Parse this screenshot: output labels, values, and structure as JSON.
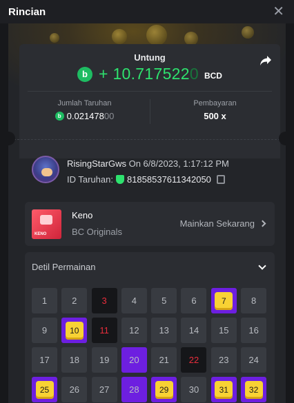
{
  "header": {
    "title": "Rincian",
    "close_symbol": "✕"
  },
  "summary": {
    "profit_label": "Untung",
    "profit_prefix": "+ ",
    "profit_main": "10.717522",
    "profit_trailing": "0",
    "currency": "BCD",
    "currency_icon": "bc-coin-icon",
    "bet_label": "Jumlah Taruhan",
    "bet_main": "0.021478",
    "bet_trailing": "00",
    "payout_label": "Pembayaran",
    "payout_value": "500 x",
    "accent_color": "#2ee26e"
  },
  "player": {
    "name": "RisingStarGws",
    "on_text": "On 6/8/2023, 1:17:12 PM",
    "bet_id_label": "ID Taruhan:",
    "bet_id": "81858537611342050"
  },
  "game": {
    "name": "Keno",
    "provider": "BC Originals",
    "play_label": "Mainkan Sekarang",
    "thumb_tag": "KENO"
  },
  "details": {
    "title": "Detil Permainan",
    "tiles": [
      {
        "n": "1",
        "s": "normal"
      },
      {
        "n": "2",
        "s": "normal"
      },
      {
        "n": "3",
        "s": "drawn"
      },
      {
        "n": "4",
        "s": "normal"
      },
      {
        "n": "5",
        "s": "normal"
      },
      {
        "n": "6",
        "s": "normal"
      },
      {
        "n": "7",
        "s": "hit"
      },
      {
        "n": "8",
        "s": "normal"
      },
      {
        "n": "9",
        "s": "normal"
      },
      {
        "n": "10",
        "s": "hit"
      },
      {
        "n": "11",
        "s": "drawn"
      },
      {
        "n": "12",
        "s": "normal"
      },
      {
        "n": "13",
        "s": "normal"
      },
      {
        "n": "14",
        "s": "normal"
      },
      {
        "n": "15",
        "s": "normal"
      },
      {
        "n": "16",
        "s": "normal"
      },
      {
        "n": "17",
        "s": "normal"
      },
      {
        "n": "18",
        "s": "normal"
      },
      {
        "n": "19",
        "s": "normal"
      },
      {
        "n": "20",
        "s": "picked"
      },
      {
        "n": "21",
        "s": "normal"
      },
      {
        "n": "22",
        "s": "drawn"
      },
      {
        "n": "23",
        "s": "normal"
      },
      {
        "n": "24",
        "s": "normal"
      },
      {
        "n": "25",
        "s": "hit"
      },
      {
        "n": "26",
        "s": "normal"
      },
      {
        "n": "27",
        "s": "normal"
      },
      {
        "n": "28",
        "s": "picked"
      },
      {
        "n": "29",
        "s": "hit"
      },
      {
        "n": "30",
        "s": "normal"
      },
      {
        "n": "31",
        "s": "hit"
      },
      {
        "n": "32",
        "s": "hit"
      }
    ]
  }
}
